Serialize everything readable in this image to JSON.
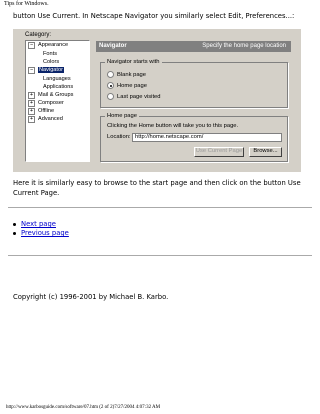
{
  "page": {
    "header_title": "Tips for Windows.",
    "intro": "button Use Current. In Netscape Navigator you similarly select Edit, Preferences...:",
    "paragraph": "Here it is similarly easy to browse to the start page and then click on the button Use Current Page.",
    "links": [
      "Next page",
      "Previous page"
    ],
    "copyright": "Copyright (c) 1996-2001 by Michael B. Karbo.",
    "footer": "http://www.karbosguide.com/software/07.htm (2 of 2)7/27/2004 4:07:32 AM"
  },
  "dialog": {
    "category_label": "Category:",
    "tree": [
      {
        "label": "Appearance",
        "expand": "−"
      },
      {
        "label": "Fonts"
      },
      {
        "label": "Colors"
      },
      {
        "label": "Navigator",
        "expand": "−",
        "selected": true
      },
      {
        "label": "Languages"
      },
      {
        "label": "Applications"
      },
      {
        "label": "Mail & Groups",
        "expand": "+"
      },
      {
        "label": "Composer",
        "expand": "+"
      },
      {
        "label": "Offline",
        "expand": "+"
      },
      {
        "label": "Advanced",
        "expand": "+"
      }
    ],
    "section_title": "Navigator",
    "section_desc": "Specify the home page location",
    "starts_with_label": "Navigator starts with",
    "options": [
      "Blank page",
      "Home page",
      "Last page visited"
    ],
    "selected_option": "Home page",
    "home_group_label": "Home page",
    "home_text": "Clicking the Home button will take you to this page.",
    "location_label": "Location:",
    "location_value": "http://home.netscape.com/",
    "use_current_label": "Use Current Page",
    "browse_label": "Browse..."
  }
}
